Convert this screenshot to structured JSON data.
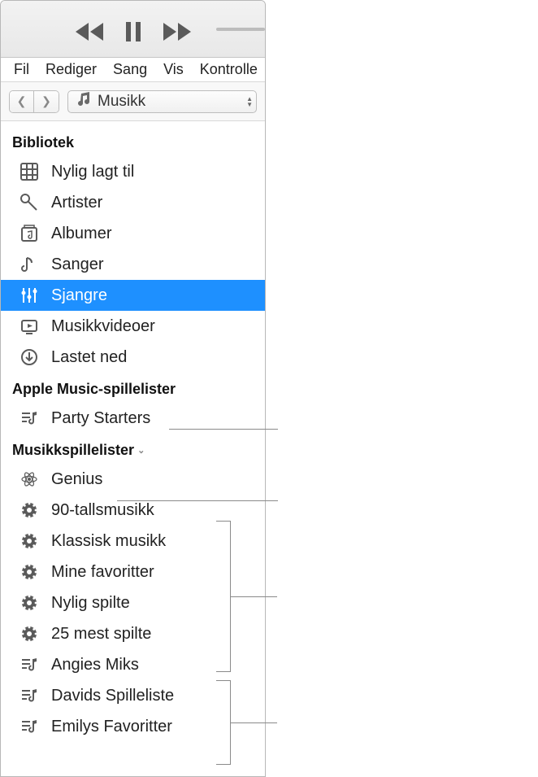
{
  "menu": {
    "file": "Fil",
    "edit": "Rediger",
    "song": "Sang",
    "view": "Vis",
    "controls": "Kontrolle"
  },
  "picker": {
    "label": "Musikk"
  },
  "sections": {
    "library": {
      "title": "Bibliotek"
    },
    "apple_playlists": {
      "title": "Apple Music-spillelister"
    },
    "music_playlists": {
      "title": "Musikkspillelister"
    }
  },
  "library": [
    {
      "label": "Nylig lagt til",
      "icon": "grid-icon"
    },
    {
      "label": "Artister",
      "icon": "mic-icon"
    },
    {
      "label": "Albumer",
      "icon": "album-icon"
    },
    {
      "label": "Sanger",
      "icon": "note-icon"
    },
    {
      "label": "Sjangre",
      "icon": "guitar-icon",
      "selected": true
    },
    {
      "label": "Musikkvideoer",
      "icon": "video-icon"
    },
    {
      "label": "Lastet ned",
      "icon": "download-icon"
    }
  ],
  "apple_playlists": [
    {
      "label": "Party Starters",
      "icon": "playlist-icon"
    }
  ],
  "music_playlists": [
    {
      "label": "Genius",
      "icon": "genius-icon"
    },
    {
      "label": "90-tallsmusikk",
      "icon": "gear-icon"
    },
    {
      "label": "Klassisk musikk",
      "icon": "gear-icon"
    },
    {
      "label": "Mine favoritter",
      "icon": "gear-icon"
    },
    {
      "label": "Nylig spilte",
      "icon": "gear-icon"
    },
    {
      "label": "25 mest spilte",
      "icon": "gear-icon"
    },
    {
      "label": "Angies Miks",
      "icon": "playlist-icon"
    },
    {
      "label": "Davids Spilleliste",
      "icon": "playlist-icon"
    },
    {
      "label": "Emilys Favoritter",
      "icon": "playlist-icon"
    }
  ]
}
